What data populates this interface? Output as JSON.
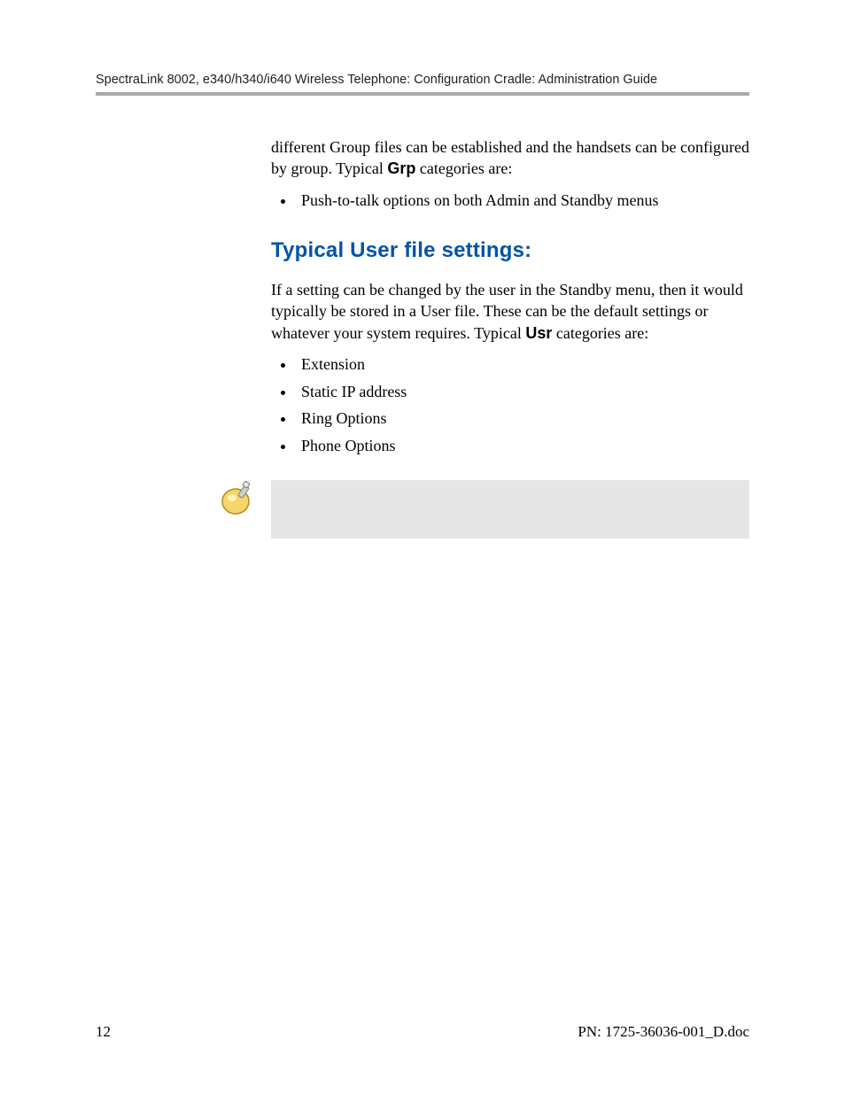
{
  "header": {
    "title": "SpectraLink 8002, e340/h340/i640 Wireless Telephone: Configuration Cradle: Administration Guide"
  },
  "intro": {
    "para_before": "different Group files can be established and the handsets can be configured by group. Typical ",
    "grp_label": "Grp",
    "para_after": " categories are:",
    "bullets": [
      "Push-to-talk options on both Admin and Standby menus"
    ]
  },
  "section": {
    "heading": "Typical User file settings:",
    "para_before": "If a setting can be changed by the user in the Standby menu, then it would typically be stored in a User file. These can be the default settings or whatever your system requires. Typical ",
    "usr_label": "Usr",
    "para_after": " categories are:",
    "bullets": [
      "Extension",
      "Static IP address",
      "Ring Options",
      "Phone Options"
    ]
  },
  "footer": {
    "page_number": "12",
    "doc_ref": "PN: 1725-36036-001_D.doc"
  }
}
